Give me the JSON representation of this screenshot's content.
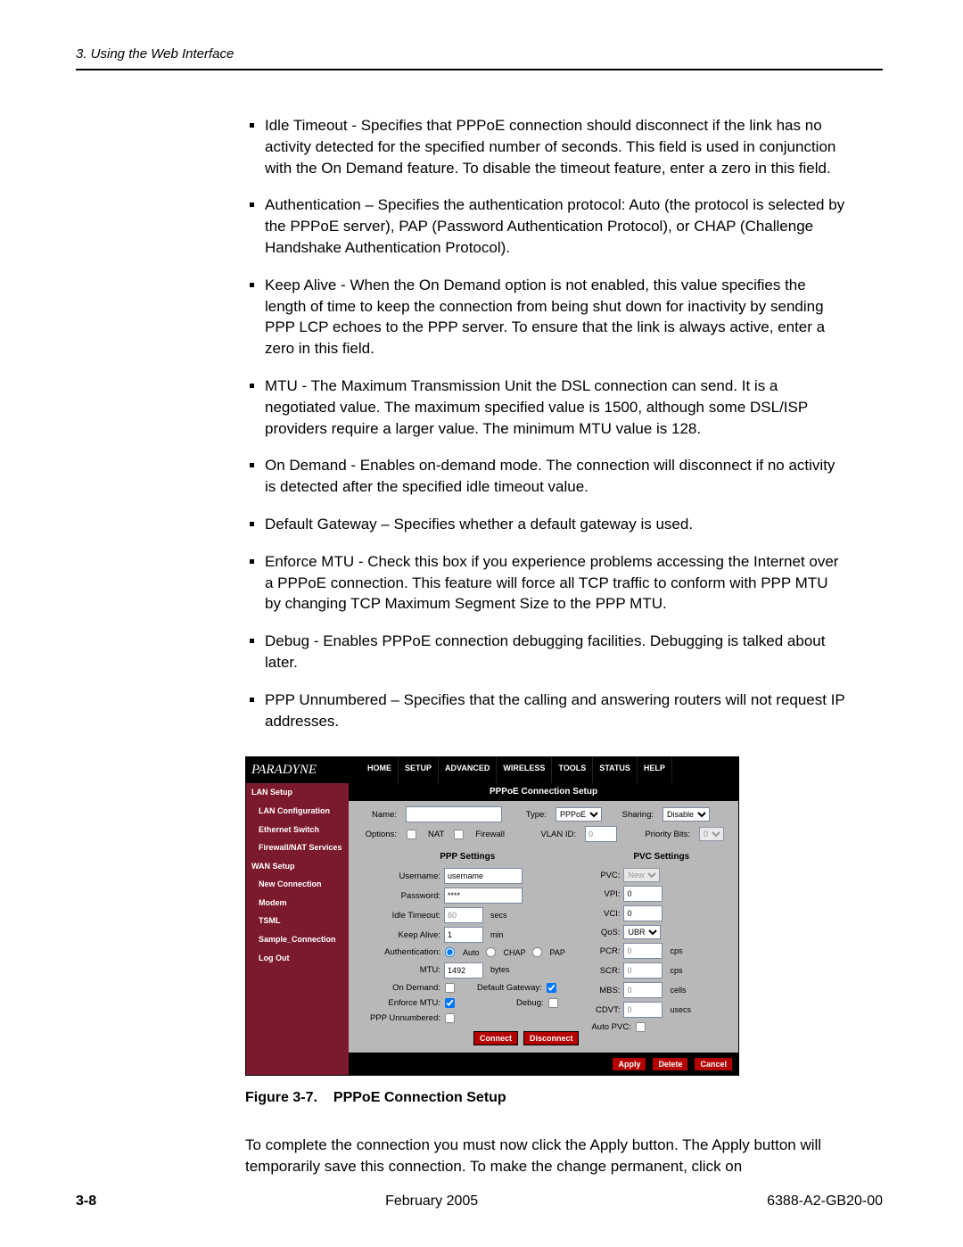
{
  "header": {
    "text": "3. Using the Web Interface"
  },
  "bullets": [
    "Idle Timeout - Specifies that PPPoE connection should disconnect if the link has no activity detected for the specified number of seconds. This field is used in conjunction with the On Demand feature. To disable the timeout feature, enter a zero in this field.",
    "Authentication – Specifies the authentication protocol: Auto (the protocol is selected by the PPPoE server), PAP (Password Authentication Protocol), or CHAP (Challenge Handshake Authentication Protocol).",
    "Keep Alive - When the On Demand option is not enabled, this value specifies the length of time to keep the connection from being shut down for inactivity by sending PPP LCP echoes to the PPP server. To ensure that the link is always active, enter a zero in this field.",
    "MTU - The Maximum Transmission Unit the DSL connection can send. It is a negotiated value. The maximum specified value is 1500, although some DSL/ISP providers require a larger value. The minimum MTU value is 128.",
    "On Demand - Enables on-demand mode. The connection will disconnect if no activity is detected after the specified idle timeout value.",
    "Default Gateway – Specifies whether a default gateway is used.",
    "Enforce MTU - Check this box if you experience problems accessing the Internet over a PPPoE connection. This feature will force all TCP traffic to conform with PPP MTU by changing TCP Maximum Segment Size to the PPP MTU.",
    "Debug - Enables PPPoE connection debugging facilities.  Debugging is talked about later.",
    "PPP Unnumbered – Specifies that the calling and answering routers will not request IP addresses."
  ],
  "figure": {
    "num": "Figure 3-7.",
    "title": "PPPoE Connection Setup"
  },
  "closing": "To complete the connection you must now click the Apply button. The Apply button will temporarily save this connection. To make the change permanent, click on",
  "footer": {
    "page": "3-8",
    "center": "February 2005",
    "right": "6388-A2-GB20-00"
  },
  "ss": {
    "brand": "PARADYNE",
    "tabs": [
      "HOME",
      "SETUP",
      "ADVANCED",
      "WIRELESS",
      "TOOLS",
      "STATUS",
      "HELP"
    ],
    "sidebar": {
      "sections": [
        {
          "head": "LAN Setup",
          "items": [
            "LAN Configuration",
            "Ethernet Switch",
            "Firewall/NAT Services"
          ]
        },
        {
          "head": "WAN Setup",
          "items": [
            "New Connection",
            "Modem",
            "TSML",
            "Sample_Connection",
            "Log Out"
          ]
        }
      ]
    },
    "main": {
      "title": "PPPoE Connection Setup",
      "name_l": "Name:",
      "name_v": "",
      "type_l": "Type:",
      "type_v": "PPPoE",
      "sharing_l": "Sharing:",
      "sharing_v": "Disable",
      "options_l": "Options:",
      "opt_nat": "NAT",
      "opt_fw": "Firewall",
      "vlan_l": "VLAN ID:",
      "vlan_v": "0",
      "prio_l": "Priority Bits:",
      "prio_v": "0",
      "ppp_title": "PPP Settings",
      "pvc_title": "PVC Settings",
      "username_l": "Username:",
      "username_v": "username",
      "password_l": "Password:",
      "password_v": "****",
      "idle_l": "Idle Timeout:",
      "idle_v": "60",
      "idle_u": "secs",
      "keep_l": "Keep Alive:",
      "keep_v": "1",
      "keep_u": "min",
      "auth_l": "Authentication:",
      "auth_auto": "Auto",
      "auth_chap": "CHAP",
      "auth_pap": "PAP",
      "mtu_l": "MTU:",
      "mtu_v": "1492",
      "mtu_u": "bytes",
      "ond_l": "On Demand:",
      "dgw_l": "Default Gateway:",
      "enf_l": "Enforce MTU:",
      "dbg_l": "Debug:",
      "pppun_l": "PPP Unnumbered:",
      "connect": "Connect",
      "disconnect": "Disconnect",
      "pvc_l": "PVC:",
      "pvc_v": "New",
      "vpi_l": "VPI:",
      "vpi_v": "0",
      "vci_l": "VCI:",
      "vci_v": "0",
      "qos_l": "QoS:",
      "qos_v": "UBR",
      "pcr_l": "PCR:",
      "pcr_v": "0",
      "pcr_u": "cps",
      "scr_l": "SCR:",
      "scr_v": "0",
      "scr_u": "cps",
      "mbs_l": "MBS:",
      "mbs_v": "0",
      "mbs_u": "cells",
      "cdvt_l": "CDVT:",
      "cdvt_v": "0",
      "cdvt_u": "usecs",
      "autopvc_l": "Auto PVC:",
      "apply": "Apply",
      "delete": "Delete",
      "cancel": "Cancel"
    }
  }
}
